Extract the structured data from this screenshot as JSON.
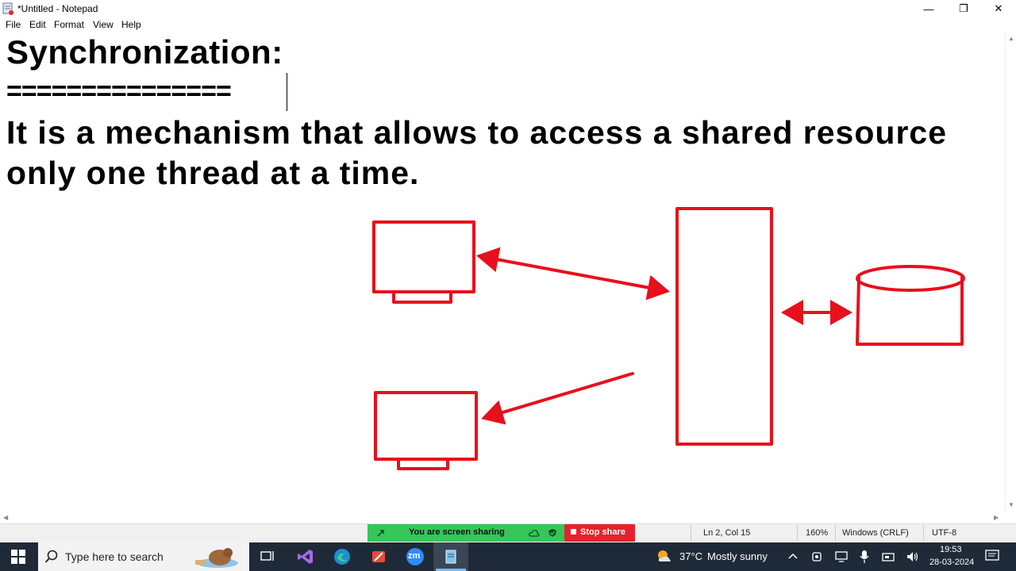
{
  "window": {
    "title": "*Untitled - Notepad",
    "minimize_glyph": "—",
    "restore_glyph": "❐",
    "close_glyph": "✕"
  },
  "menu": [
    "File",
    "Edit",
    "Format",
    "View",
    "Help"
  ],
  "document": {
    "line1": "Synchronization:",
    "line2": "===============",
    "line3": "It is a mechanism that allows to access a shared resource",
    "line4": "only one thread at a time."
  },
  "drawing": {
    "stroke_color": "#e8101c"
  },
  "statusbar": {
    "position": "Ln 2, Col 15",
    "zoom": "160%",
    "line_ending": "Windows (CRLF)",
    "encoding": "UTF-8"
  },
  "zoom_share": {
    "message": "You are screen sharing",
    "stop_label": "Stop share",
    "bar_color": "#35c759",
    "stop_color": "#e5222c"
  },
  "taskbar": {
    "search_placeholder": "Type here to search",
    "pinned": [
      "task-view",
      "visual-studio",
      "edge",
      "snipping-tool",
      "zoom",
      "notepad"
    ],
    "zoom_label": "zm",
    "weather_temp": "37°C",
    "weather_text": "Mostly sunny",
    "time": "19:53",
    "date": "28-03-2024"
  }
}
